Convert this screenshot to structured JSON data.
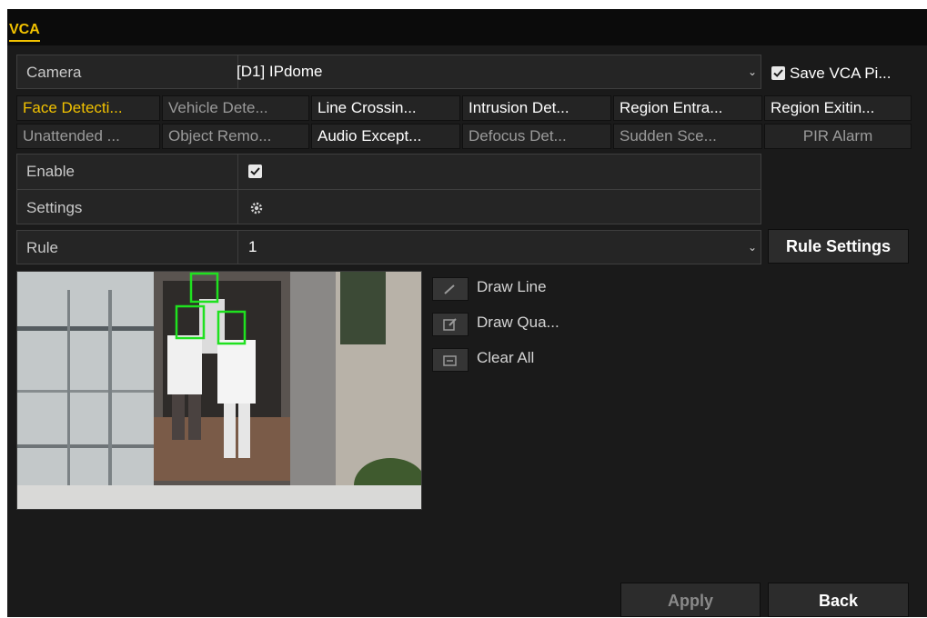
{
  "window": {
    "title": "VCA"
  },
  "camera": {
    "label": "Camera",
    "value": "[D1] IPdome",
    "save_label": "Save VCA Pi..."
  },
  "tabs": [
    [
      "Face Detecti...",
      "Vehicle Dete...",
      "Line Crossin...",
      "Intrusion Det...",
      "Region Entra...",
      "Region Exitin..."
    ],
    [
      "Unattended ...",
      "Object Remo...",
      "Audio Except...",
      "Defocus Det...",
      "Sudden Sce...",
      "PIR Alarm"
    ]
  ],
  "enable": {
    "label": "Enable",
    "checked": true
  },
  "settings": {
    "label": "Settings",
    "icon": "gear-icon"
  },
  "rule": {
    "label": "Rule",
    "value": "1",
    "button": "Rule Settings"
  },
  "tools": {
    "draw_line": "Draw Line",
    "draw_quad": "Draw Qua...",
    "clear_all": "Clear All"
  },
  "footer": {
    "apply": "Apply",
    "back": "Back"
  },
  "colors": {
    "accent": "#f2c200",
    "panel": "#1a1a1a",
    "detection_box": "#1fe11f"
  }
}
